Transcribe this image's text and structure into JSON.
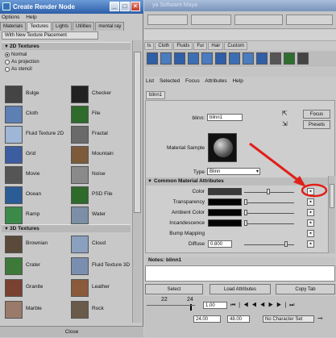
{
  "create_render_node": {
    "title": "Create Render Node",
    "menu": [
      "Options",
      "Help"
    ],
    "tabs": [
      "Materials",
      "Textures",
      "Lights",
      "Utilities",
      "mental ray"
    ],
    "active_tab": "Textures",
    "placement_label": "With New Texture Placement",
    "section_2d": "2D Textures",
    "radio_options": [
      "Normal",
      "As projection",
      "As stencil"
    ],
    "nodes_2d": [
      {
        "name": "Bulge",
        "swatch": "#444444"
      },
      {
        "name": "Checker",
        "swatch": "#222222"
      },
      {
        "name": "Cloth",
        "swatch": "#5d7fb3"
      },
      {
        "name": "File",
        "swatch": "#2f6b2a"
      },
      {
        "name": "Fluid Texture 2D",
        "swatch": "#9fb6d6"
      },
      {
        "name": "Fractal",
        "swatch": "#6a6a6a"
      },
      {
        "name": "Grid",
        "swatch": "#3a5ea0"
      },
      {
        "name": "Mountain",
        "swatch": "#7d5a3a"
      },
      {
        "name": "Movie",
        "swatch": "#555555"
      },
      {
        "name": "Noise",
        "swatch": "#8a8a8a"
      },
      {
        "name": "Ocean",
        "swatch": "#2a5c96"
      },
      {
        "name": "PSD File",
        "swatch": "#2e6a2a"
      },
      {
        "name": "Ramp",
        "swatch": "#3b8a4a"
      },
      {
        "name": "Water",
        "swatch": "#7d8fa6"
      }
    ],
    "section_3d": "3D Textures",
    "nodes_3d": [
      {
        "name": "Brownian",
        "swatch": "#5a4a3a"
      },
      {
        "name": "Cloud",
        "swatch": "#8aa0bf"
      },
      {
        "name": "Crater",
        "swatch": "#3d7a3a"
      },
      {
        "name": "Fluid Texture 3D",
        "swatch": "#7a8fb0"
      },
      {
        "name": "Granite",
        "swatch": "#7a4030"
      },
      {
        "name": "Leather",
        "swatch": "#8a5a3a"
      },
      {
        "name": "Marble",
        "swatch": "#9a7a6a"
      },
      {
        "name": "Rock",
        "swatch": "#6a5a4a"
      }
    ],
    "close_label": "Close"
  },
  "maya": {
    "title": "ya Software  Maya",
    "shelf_tabs": [
      "ls",
      "Cloth",
      "Fluids",
      "Fur",
      "Hair",
      "Custom"
    ],
    "attr_menu": [
      "List",
      "Selected",
      "Focus",
      "Attributes",
      "Help"
    ],
    "node_tab": "blinn1",
    "blinn_label": "blinn:",
    "blinn_value": "blinn1",
    "focus_label": "Focus",
    "presets_label": "Presets",
    "material_sample_label": "Material Sample",
    "type_label": "Type",
    "type_value": "Blinn",
    "section_label": "Common Material Attributes",
    "attributes": [
      {
        "label": "Color",
        "swatch": "#3a3a3a"
      },
      {
        "label": "Transparency",
        "swatch": "#050505"
      },
      {
        "label": "Ambient Color",
        "swatch": "#050505"
      },
      {
        "label": "Incandescence",
        "swatch": "#050505"
      },
      {
        "label": "Bump Mapping",
        "swatch": ""
      },
      {
        "label": "Diffuse",
        "value": "0.800"
      }
    ],
    "notes_label": "Notes: blinn1",
    "bottom_buttons": [
      "Select",
      "Load Attributes",
      "Copy Tab"
    ],
    "time_ticks": [
      "22",
      "24"
    ],
    "time_field": "1.00",
    "range_start": "24.00",
    "range_end": "48.00",
    "char_set": "No Character Set",
    "accent_color": "#e0201a"
  }
}
